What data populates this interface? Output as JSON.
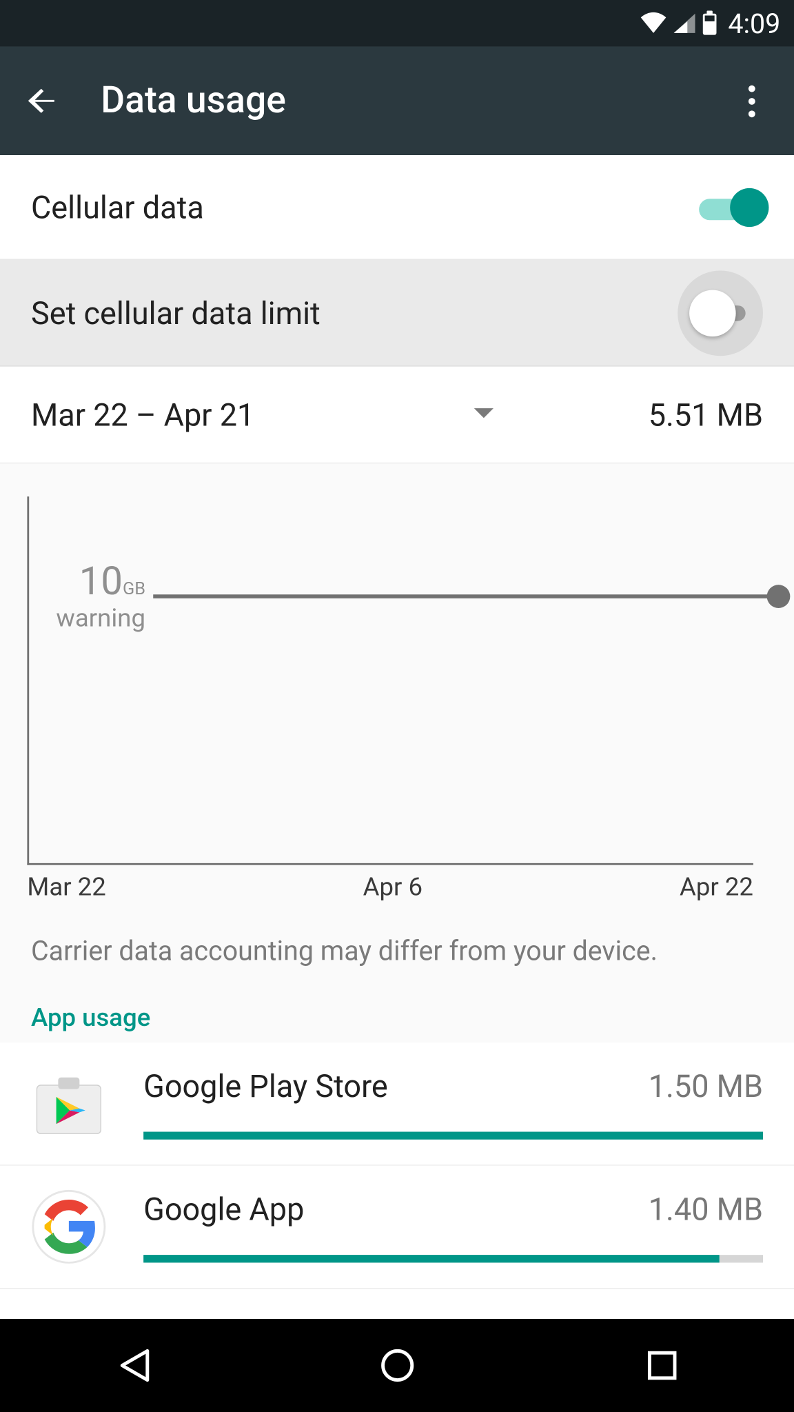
{
  "status": {
    "time": "4:09"
  },
  "header": {
    "title": "Data usage"
  },
  "settings": {
    "cellular_data_label": "Cellular data",
    "set_limit_label": "Set cellular data limit"
  },
  "period": {
    "range": "Mar 22 – Apr 21",
    "total": "5.51 MB"
  },
  "chart_data": {
    "type": "line",
    "warning_value": "10",
    "warning_unit": "GB",
    "warning_label": "warning",
    "x_ticks": [
      "Mar 22",
      "Apr 6",
      "Apr 22"
    ],
    "ylim_gb": [
      0,
      10
    ],
    "usage_mb": 5.51
  },
  "note": "Carrier data accounting may differ from your device.",
  "section_label": "App usage",
  "apps": [
    {
      "name": "Google Play Store",
      "usage": "1.50 MB",
      "pct": 100
    },
    {
      "name": "Google App",
      "usage": "1.40 MB",
      "pct": 93
    }
  ]
}
